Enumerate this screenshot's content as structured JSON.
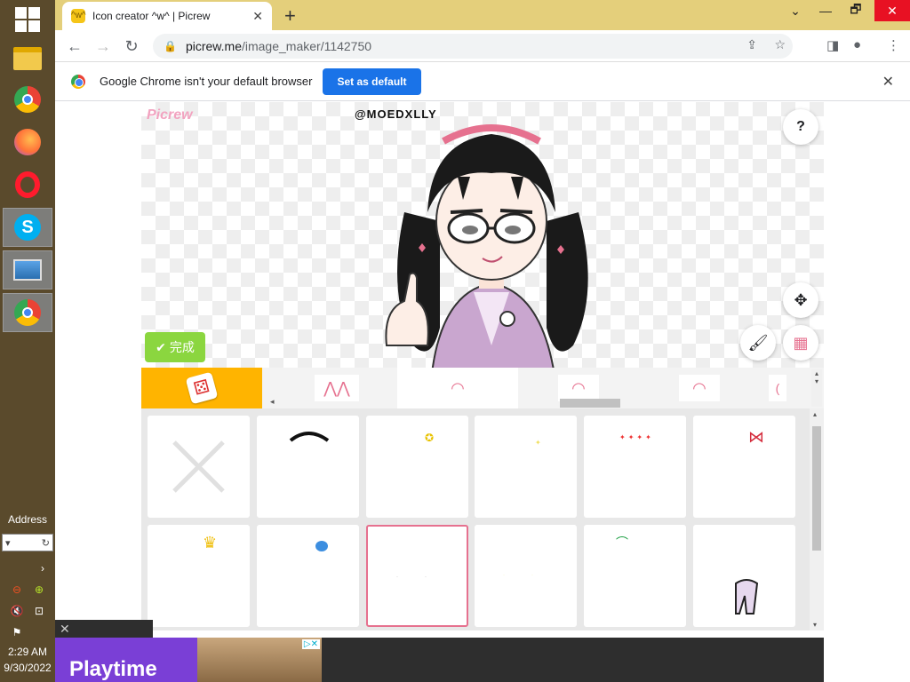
{
  "taskbar": {
    "address_label": "Address",
    "clock_time": "2:29 AM",
    "clock_date": "9/30/2022"
  },
  "browser": {
    "tab_title": "Icon creator ^w^ | Picrew",
    "tab_favicon": "^w^",
    "url_host": "picrew.me",
    "url_path": "/image_maker/1142750",
    "new_tab": "+",
    "min_icon": "⌄",
    "restore_icon": "🗗",
    "close_icon": "✕"
  },
  "infobar": {
    "message": "Google Chrome isn't your default browser",
    "button_label": "Set as default"
  },
  "picrew": {
    "logo": "Picrew",
    "credit": "@MOEDXLLY",
    "help": "?",
    "done_label": "完成",
    "move_icon": "✥",
    "brush_icon": "🖌",
    "grid_icon": "▦"
  },
  "ad": {
    "headline": "Playtime",
    "ad_choices": "▷✕",
    "close": "✕"
  },
  "colors": {
    "accent_orange": "#ffb400",
    "done_green": "#8bd63f",
    "selected_border": "#e6718f",
    "chrome_blue": "#1a73e8",
    "tabbar_yellow": "#e4cf7b"
  }
}
